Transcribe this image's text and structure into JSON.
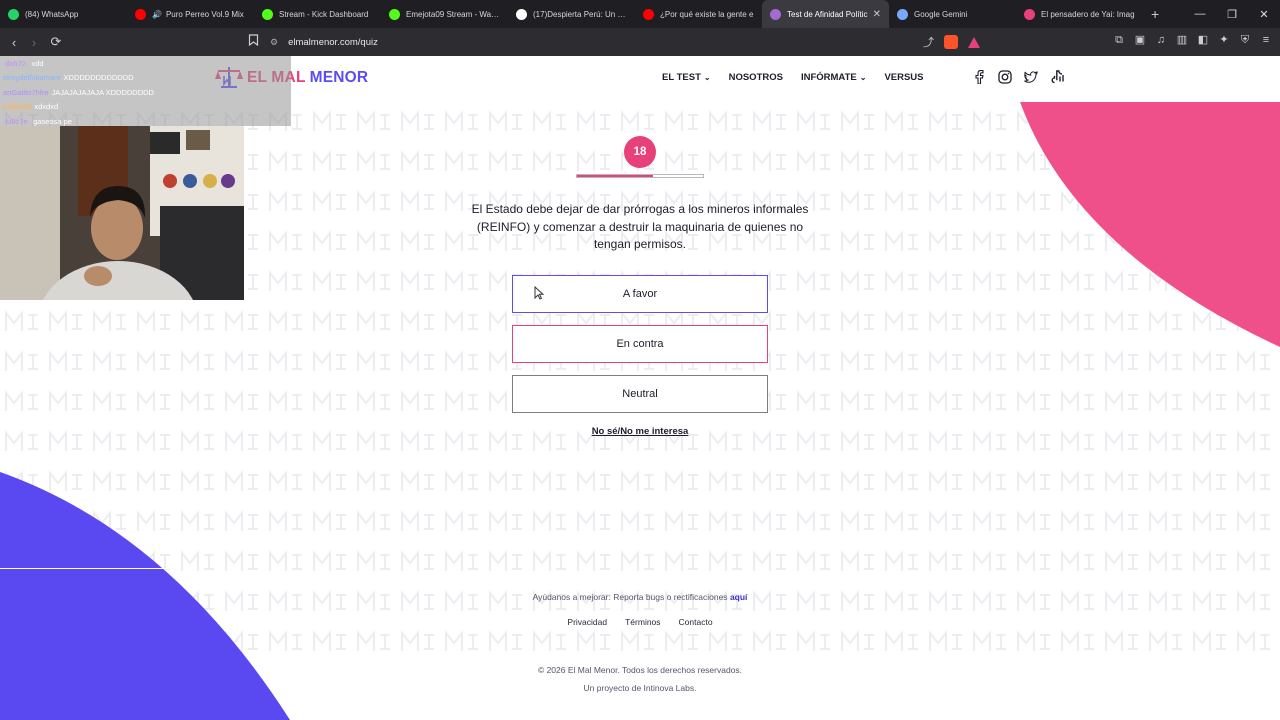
{
  "browser": {
    "tabs": [
      {
        "title": "(84) WhatsApp",
        "icon": "whatsapp-icon",
        "color": "#25d366",
        "active": false
      },
      {
        "title": "Puro Perreo Vol.9 Mix",
        "icon": "youtube-icon",
        "color": "#ff0000",
        "active": false,
        "audio": true
      },
      {
        "title": "Stream - Kick Dashboard",
        "icon": "kick-icon",
        "color": "#53fc18",
        "active": false
      },
      {
        "title": "Emejota09 Stream - Watch",
        "icon": "kick-icon",
        "color": "#53fc18",
        "active": false
      },
      {
        "title": "(17)Despierta Perú: Un Llam",
        "icon": "tiktok-icon",
        "color": "#ffffff",
        "active": false
      },
      {
        "title": "¿Por qué existe la gente e",
        "icon": "youtube-icon",
        "color": "#ff0000",
        "active": false
      },
      {
        "title": "Test de Afinidad Polític",
        "icon": "elmalmenor-icon",
        "color": "#a36bd1",
        "active": true
      },
      {
        "title": "Google Gemini",
        "icon": "gemini-icon",
        "color": "#7aa7ff",
        "active": false
      },
      {
        "title": "El pensadero de Yai: Imag",
        "icon": "blog-icon",
        "color": "#e8417a",
        "active": false
      }
    ],
    "url": "elmalmenor.com/quiz"
  },
  "site": {
    "logo_part1": "EL MAL",
    "logo_part2": "MENOR",
    "nav": [
      {
        "label": "EL TEST",
        "dropdown": true
      },
      {
        "label": "NOSOTROS",
        "dropdown": false
      },
      {
        "label": "INFÓRMATE",
        "dropdown": true
      },
      {
        "label": "VERSUS",
        "dropdown": false
      }
    ],
    "social": [
      "facebook-icon",
      "instagram-icon",
      "twitter-icon",
      "tiktok-icon"
    ]
  },
  "quiz": {
    "question_number": "18",
    "progress_fraction": 0.6,
    "question": "El Estado debe dejar de dar prórrogas a los mineros informales (REINFO) y comenzar a destruir la maquinaria de quienes no tengan permisos.",
    "options": [
      "A favor",
      "En contra",
      "Neutral"
    ],
    "skip": "No sé/No me interesa"
  },
  "footer": {
    "help_text": "Ayúdanos a mejorar: Reporta bugs o rectificaciones",
    "help_link": "aquí",
    "links": [
      "Privacidad",
      "Términos",
      "Contacto"
    ],
    "copyright": "© 2026 El Mal Menor. Todos los derechos reservados.",
    "credit": "Un proyecto de Intinova Labs."
  },
  "overlay": {
    "chat": [
      {
        "user": "·dxh72·",
        "msg": "xdd",
        "color": "#c48cff"
      },
      {
        "user": "elreydelfrikomare",
        "msg": "XDDDDDDDDDDDD",
        "color": "#8ab4ff"
      },
      {
        "user": "anGatito7hfre",
        "msg": "JAJAJAJAJAJA XDDDDDDDD",
        "color": "#b28cff"
      },
      {
        "user": "luqitto88",
        "msg": "xdxdxd",
        "color": "#ffb347"
      },
      {
        "user": "·lu9z7e·",
        "msg": "gaseosa pe",
        "color": "#c48cff"
      }
    ]
  },
  "colors": {
    "accent_pink": "#e8417a",
    "accent_purple": "#5b4df0",
    "text": "#1d1d2b"
  }
}
